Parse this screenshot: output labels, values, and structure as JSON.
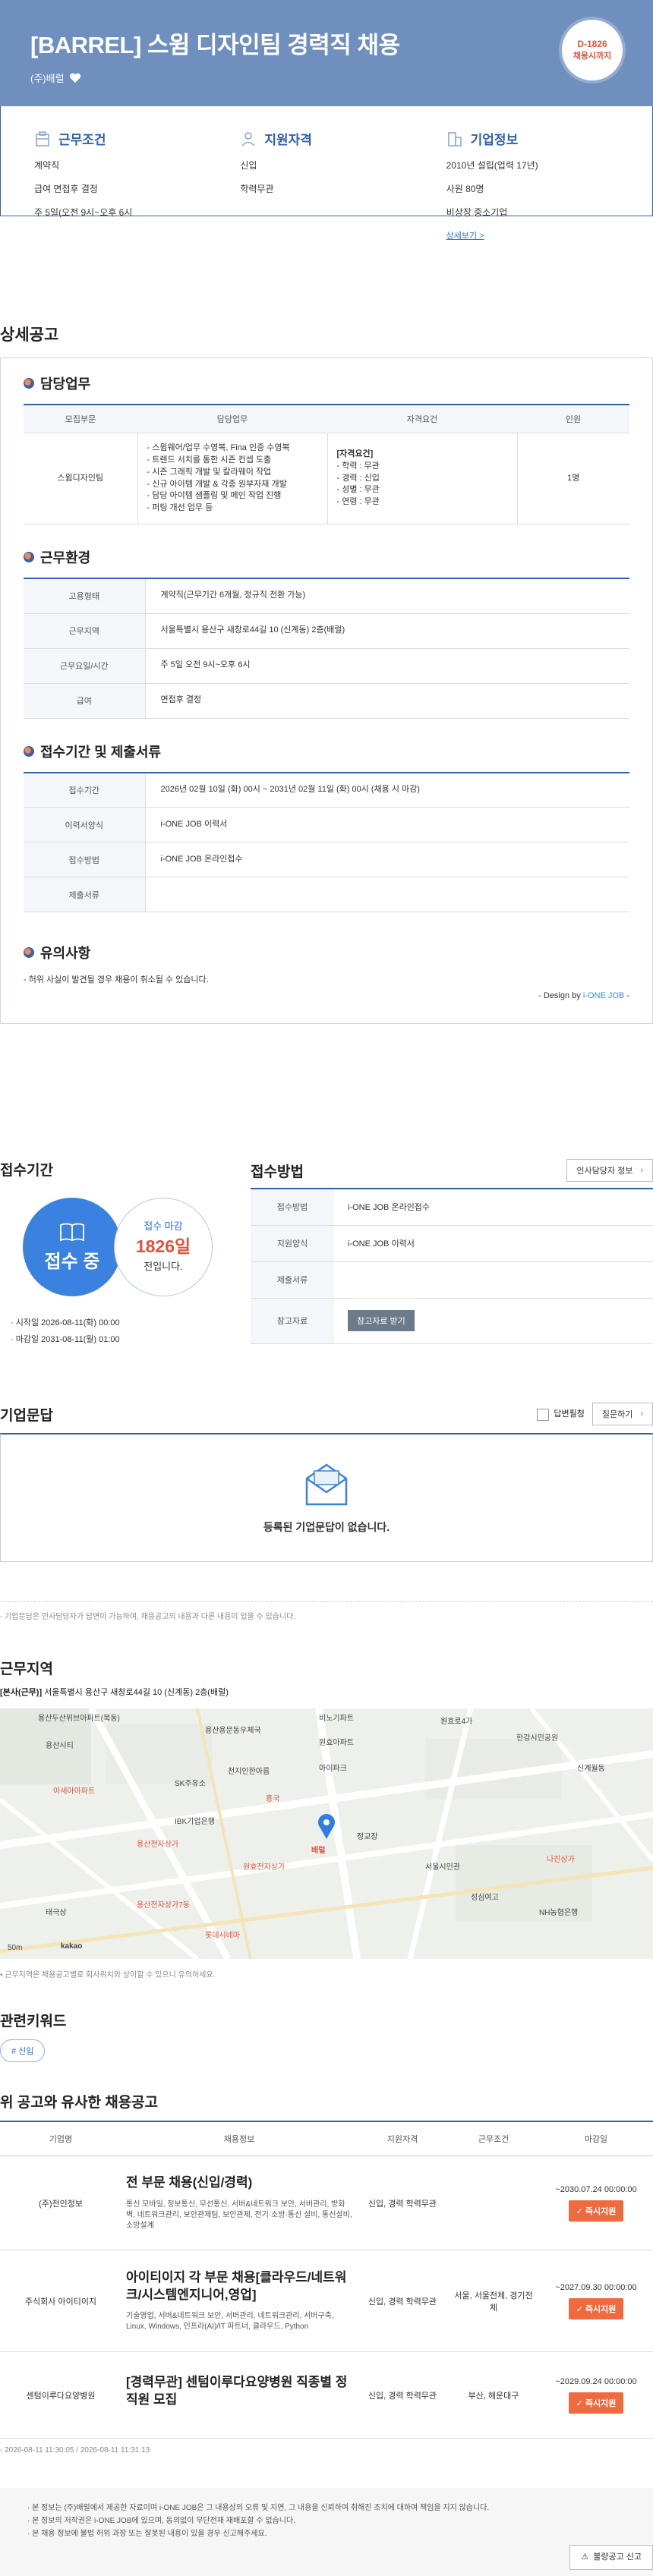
{
  "header": {
    "title": "[BARREL] 스윔 디자인팀 경력직 채용",
    "company": "(주)배럴",
    "dday": "D-1826",
    "dday_label": "채용시까지"
  },
  "summary": {
    "conditions": {
      "title": "근무조건",
      "lines": [
        "계약직",
        "급여 면접후 결정",
        "주 5일(오전 9시~오후 6시"
      ]
    },
    "qualifications": {
      "title": "지원자격",
      "lines": [
        "신입",
        "학력무관"
      ]
    },
    "company_info": {
      "title": "기업정보",
      "lines": [
        "2010년 설립(업력 17년)",
        "사원 80명",
        "비상장 중소기업"
      ],
      "link": "상세보기 >"
    }
  },
  "detail": {
    "section_title": "상세공고",
    "duty": {
      "title": "담당업무",
      "headers": [
        "모집부문",
        "담당업무",
        "자격요건",
        "인원"
      ],
      "row": {
        "part": "스윔디자인팀",
        "tasks": [
          "- 스윔웨어/업무 수영복, Fina 인증 수영복",
          "- 트렌드 서치를 통한 시즌 컨셉 도출",
          "- 시즌 그래픽 개발 및 칼라웨이 작업",
          "- 신규 아이템 개발 & 각종 원부자재 개발",
          "- 담당 아이템 샘플링 및 메인 작업 진행",
          "- 퍼팅 개선 업무 등"
        ],
        "req_title": "[자격요건]",
        "reqs": [
          "- 학력 : 무관",
          "- 경력 : 신입",
          "- 성별 : 무관",
          "- 연령 : 무관"
        ],
        "count": "1명"
      }
    },
    "env": {
      "title": "근무환경",
      "rows": [
        {
          "k": "고용형태",
          "v": "계약직(근무기간 6개월, 정규직 전환 가능)"
        },
        {
          "k": "근무지역",
          "v": "서울특별시 용산구 새창로44길 10 (신계동) 2층(배럴)"
        },
        {
          "k": "근무요일/시간",
          "v": "주 5일 오전 9시~오후 6시"
        },
        {
          "k": "급여",
          "v": "면접후 결정"
        }
      ]
    },
    "period": {
      "title": "접수기간 및 제출서류",
      "rows": [
        {
          "k": "접수기간",
          "v": "2026년 02월 10일 (화) 00시 ~ 2031년 02월 11일 (화) 00시 (채용 시 마감)"
        },
        {
          "k": "이력서양식",
          "v": "i-ONE JOB 이력서"
        },
        {
          "k": "접수방법",
          "v": "i-ONE JOB 온라인접수"
        },
        {
          "k": "제출서류",
          "v": ""
        }
      ]
    },
    "notice": {
      "title": "유의사항",
      "text": "- 허위 사실이 발견될 경우 채용이 취소될 수 있습니다."
    },
    "design_by_prefix": "- Design by ",
    "design_by_brand": "i-ONE JOB",
    "design_by_suffix": " -"
  },
  "apply": {
    "period_title": "접수기간",
    "status": "접수 중",
    "deadline_label": "접수 마감",
    "deadline_days": "1826일",
    "deadline_suffix": "전입니다.",
    "start": "· 시작일 2026-08-11(화) 00:00",
    "end": "· 마감일 2031-08-11(월) 01:00",
    "method_title": "접수방법",
    "hr_button": "인사담당자 정보",
    "rows": [
      {
        "k": "접수방법",
        "v": "i-ONE JOB 온라인접수"
      },
      {
        "k": "지원양식",
        "v": "i-ONE JOB 이력서"
      },
      {
        "k": "제출서류",
        "v": ""
      },
      {
        "k": "참고자료",
        "v": ""
      }
    ],
    "reference_button": "참고자료 받기"
  },
  "qa": {
    "title": "기업문답",
    "only_answered": "답변필청",
    "ask_button": "질문하기",
    "empty": "등록된 기업문답이 없습니다.",
    "note": "- 기업문답은 인사담당자가 답변이 가능하며, 채용공고의 내용과 다른 내용이 있을 수 있습니다."
  },
  "location": {
    "title": "근무지역",
    "label": "[본사(근무)]",
    "address": " 서울특별시 용산구 새창로44길 10 (신계동) 2층(배럴)",
    "note": "• 근무지역은 채용공고별로 회사위치와 상이할 수 있으니 유의하세요.",
    "map_labels": [
      "용산두산위브아파트(북동)",
      "비노기파트",
      "용산용문동우체국",
      "원효아파트",
      "용산시티",
      "원효로4가",
      "흥국",
      "한강시민공원",
      "천지인한아름",
      "아이파크",
      "SK주유소",
      "IBK기업은행",
      "아세아아파트",
      "용산전자상가",
      "원효전자상가",
      "배럴",
      "정교장",
      "서울시민관",
      "나진상가",
      "성심여고",
      "용산전자상가7동",
      "태극상",
      "신계월동",
      "NH농협은행",
      "롯데시네마"
    ],
    "scale": "50m",
    "map_brand": "kakao"
  },
  "keywords": {
    "title": "관련키워드",
    "items": [
      "# 신입"
    ]
  },
  "similar": {
    "title": "위 공고와 유사한 채용공고",
    "headers": [
      "기업명",
      "채용정보",
      "지원자격",
      "근무조건",
      "마감일"
    ],
    "rows": [
      {
        "company": "(주)전인정보",
        "title": "전 부문 채용(신입/경력)",
        "desc": "통신 모바일, 정보통신, 무선통신, 서버&네트워크 보안, 서버관리, 방화벽, 네트워크관리, 보안관제팀, 보안관제, 전기·소방·통신 설비, 통신설비, 소방설계",
        "qual": "신입, 경력 학력무관",
        "cond": "",
        "deadline": "~2030.07.24 00:00:00",
        "btn": "즉시지원"
      },
      {
        "company": "주식회사 아이티이지",
        "title": "아이티이지 각 부문 채용[클라우드/네트워크/시스템엔지니어,영업]",
        "desc": "기술영업, 서버&네트워크 보안, 서버관리, 네트워크관리, 서버구축, Linux, Windows, 인프라(AI)/IT 파트너, 클라우드, Python",
        "qual": "신입, 경력 학력무관",
        "cond": "서울, 서울전체, 경기전체",
        "deadline": "~2027.09.30 00:00:00",
        "btn": "즉시지원"
      },
      {
        "company": "센텀이루다요양병원",
        "title": "[경력무관] 센텀이루다요양병원 직종별 정직원 모집",
        "desc": "",
        "qual": "신입, 경력 학력무관",
        "cond": "부산, 해운대구",
        "deadline": "~2029.09.24 00:00:00",
        "btn": "즉시지원"
      }
    ]
  },
  "footer": {
    "dates": "- 2026-08-11 11:30:05 / 2026-08-11 11:31:13",
    "lines": [
      "· 본 정보는 (주)배럴에서 제공한 자료이며 i-ONE JOB은 그 내용상의 오류 및 지연, 그 내용을 신뢰하여 취해진 조치에 대하여 책임을 지지 않습니다.",
      "· 본 정보의 저작권은 i-ONE JOB에 있으며, 동의없이 무단전재 재배포할 수 없습니다.",
      "· 본 채용 정보에 불법 허위 과장 또는 잘못된 내용이 있을 경우 신고해주세요."
    ],
    "report_button": "불량공고 신고"
  }
}
